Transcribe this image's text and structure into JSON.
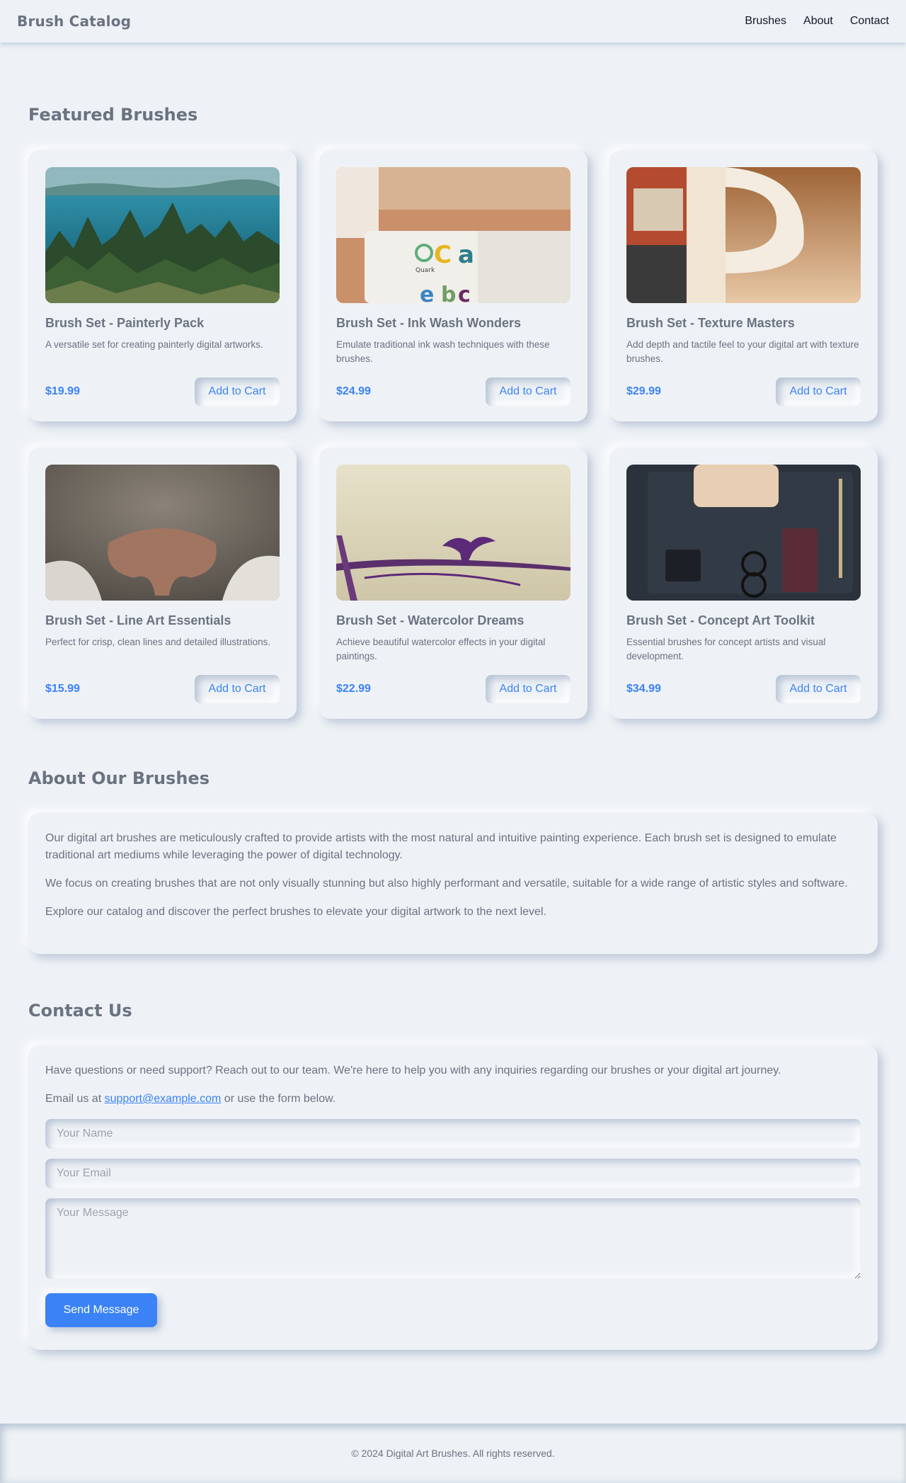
{
  "header": {
    "brand": "Brush Catalog",
    "nav": [
      "Brushes",
      "About",
      "Contact"
    ]
  },
  "featured": {
    "title": "Featured Brushes",
    "products": [
      {
        "name": "Brush Set - Painterly Pack",
        "description": "A versatile set for creating painterly digital artworks.",
        "price": "$19.99",
        "button": "Add to Cart",
        "image": "forest-lake-photo"
      },
      {
        "name": "Brush Set - Ink Wash Wonders",
        "description": "Emulate traditional ink wash techniques with these brushes.",
        "price": "$24.99",
        "button": "Add to Cart",
        "image": "mugs-photo"
      },
      {
        "name": "Brush Set - Texture Masters",
        "description": "Add depth and tactile feel to your digital art with texture brushes.",
        "price": "$29.99",
        "button": "Add to Cart",
        "image": "coffee-mug-photo"
      },
      {
        "name": "Brush Set - Line Art Essentials",
        "description": "Perfect for crisp, clean lines and detailed illustrations.",
        "price": "$15.99",
        "button": "Add to Cart",
        "image": "animal-nose-photo"
      },
      {
        "name": "Brush Set - Watercolor Dreams",
        "description": "Achieve beautiful watercolor effects in your digital paintings.",
        "price": "$22.99",
        "button": "Add to Cart",
        "image": "cormorant-photo"
      },
      {
        "name": "Brush Set - Concept Art Toolkit",
        "description": "Essential brushes for concept artists and visual development.",
        "price": "$34.99",
        "button": "Add to Cart",
        "image": "desk-flatlay-photo"
      }
    ]
  },
  "about": {
    "title": "About Our Brushes",
    "paragraphs": [
      "Our digital art brushes are meticulously crafted to provide artists with the most natural and intuitive painting experience. Each brush set is designed to emulate traditional art mediums while leveraging the power of digital technology.",
      "We focus on creating brushes that are not only visually stunning but also highly performant and versatile, suitable for a wide range of artistic styles and software.",
      "Explore our catalog and discover the perfect brushes to elevate your digital artwork to the next level."
    ]
  },
  "contact": {
    "title": "Contact Us",
    "intro": "Have questions or need support? Reach out to our team. We're here to help you with any inquiries regarding our brushes or your digital art journey.",
    "email_prefix": "Email us at ",
    "email": "support@example.com",
    "email_suffix": " or use the form below.",
    "name_placeholder": "Your Name",
    "email_placeholder": "Your Email",
    "message_placeholder": "Your Message",
    "submit": "Send Message"
  },
  "footer": {
    "copyright": "© 2024 Digital Art Brushes. All rights reserved."
  },
  "colors": {
    "background": "#eef2f6",
    "accent": "#3b82f6",
    "text": "#6b7280"
  }
}
